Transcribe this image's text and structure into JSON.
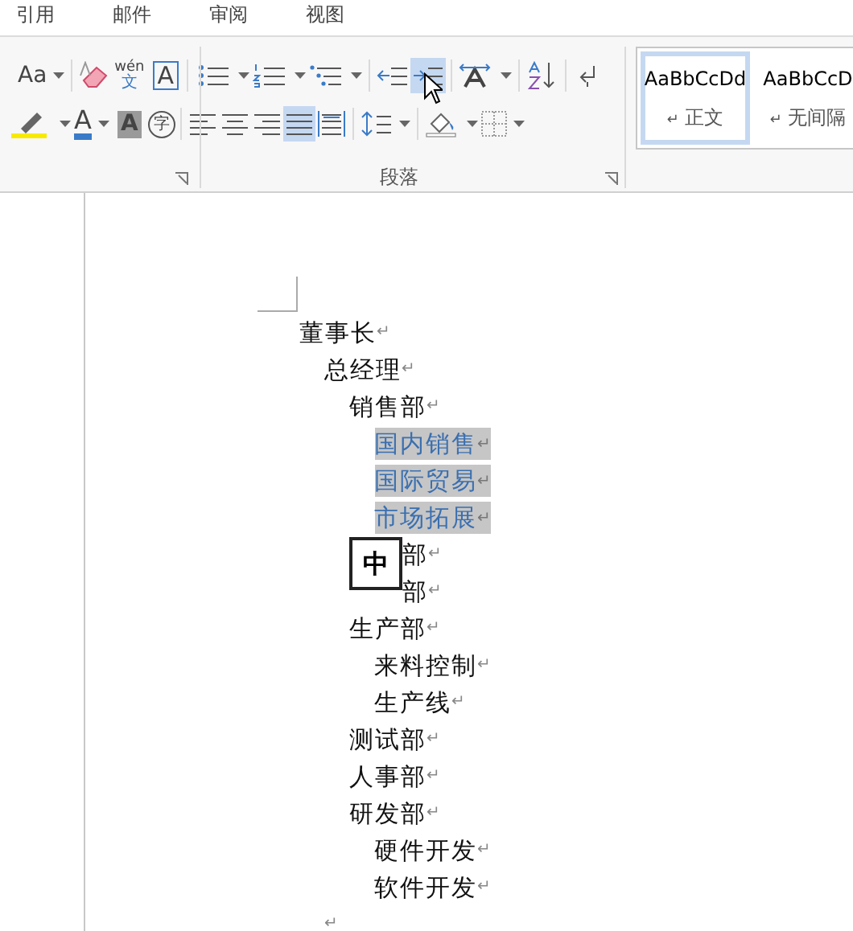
{
  "menu_tabs": [
    {
      "label": "引用"
    },
    {
      "label": "邮件"
    },
    {
      "label": "审阅"
    },
    {
      "label": "视图"
    }
  ],
  "font_group": {
    "change_case": "Aa",
    "phonetic_top": "wén",
    "phonetic_bottom": "文",
    "char_border": "A",
    "font_color": "A",
    "char_shading": "A",
    "enclose": "字"
  },
  "paragraph_group": {
    "label": "段落",
    "increase_indent_selected": true,
    "justify_selected": true
  },
  "styles": [
    {
      "preview": "AaBbCcDd",
      "mark": "↵",
      "name": "正文",
      "selected": true
    },
    {
      "preview": "AaBbCcD",
      "mark": "↵",
      "name": "无间隔",
      "selected": false
    }
  ],
  "ime_indicator": "中",
  "document": [
    {
      "text": "董事长",
      "end_mark": "↵",
      "selected": false,
      "children": [
        {
          "text": "总经理",
          "end_mark": "↵",
          "selected": false,
          "children": [
            {
              "text": "销售部",
              "end_mark": "↵",
              "selected": false,
              "children": [
                {
                  "text": "国内销售",
                  "end_mark": "↵",
                  "selected": true
                },
                {
                  "text": "国际贸易",
                  "end_mark": "↵",
                  "selected": true
                },
                {
                  "text": "市场拓展",
                  "end_mark": "↵",
                  "selected": true
                }
              ]
            },
            {
              "text": "部",
              "end_mark": "↵",
              "selected": false,
              "covered": true
            },
            {
              "text": "部",
              "end_mark": "↵",
              "selected": false,
              "covered": true
            },
            {
              "text": "生产部",
              "end_mark": "↵",
              "selected": false,
              "children": [
                {
                  "text": "来料控制",
                  "end_mark": "↵",
                  "selected": false
                },
                {
                  "text": "生产线",
                  "end_mark": "↵",
                  "selected": false
                }
              ]
            },
            {
              "text": "测试部",
              "end_mark": "↵",
              "selected": false
            },
            {
              "text": "人事部",
              "end_mark": "↵",
              "selected": false
            },
            {
              "text": "研发部",
              "end_mark": "↵",
              "selected": false,
              "children": [
                {
                  "text": "硬件开发",
                  "end_mark": "↵",
                  "selected": false
                },
                {
                  "text": "软件开发",
                  "end_mark": "↵",
                  "selected": false
                }
              ]
            }
          ]
        },
        {
          "end_mark": "↵",
          "selected": false
        }
      ]
    }
  ]
}
